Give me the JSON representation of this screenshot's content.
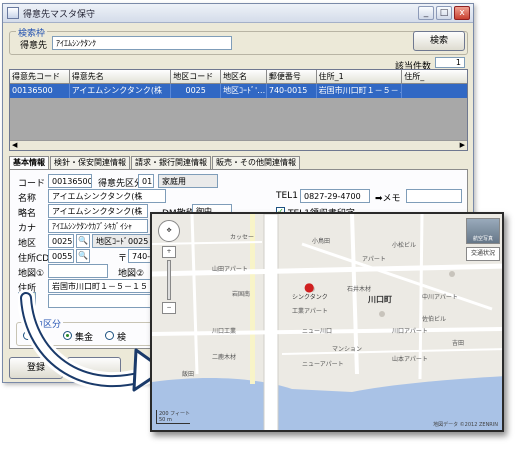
{
  "window": {
    "title": "得意先マスタ保守",
    "min_label": "_",
    "max_label": "□",
    "close_label": "x"
  },
  "search": {
    "group_title": "検索枠",
    "field_label": "得意先",
    "field_value": "ｱｲｴﾑｼﾝｸﾀﾝｸ",
    "button_label": "検索",
    "count_label": "該当件数",
    "count_value": "1"
  },
  "grid": {
    "columns": [
      "得意先コード",
      "得意先名",
      "地区コード",
      "地区名",
      "郵便番号",
      "住所_1",
      "住所_"
    ],
    "rows": [
      [
        "00136500",
        "アイエムシンクタンク(株",
        "0025",
        "地区ｺｰﾄﾞ'…",
        "740-0015",
        "岩国市川口町１－５－１５",
        ""
      ]
    ]
  },
  "tabs": [
    "基本情報",
    "検針・保安関連情報",
    "請求・銀行関連情報",
    "販売・その他関連情報"
  ],
  "form": {
    "code_label": "コード",
    "code_value": "00136500",
    "type_label": "得意先区分",
    "type_code": "01",
    "type_name": "家庭用",
    "name_label": "名称",
    "name_value": "アイエムシンクタンク(株",
    "tel_label": "TEL1",
    "tel_value": "0827-29-4700",
    "memo_label": "➡メモ",
    "short_label": "略名",
    "short_value": "アイエムシンクタンク(株",
    "dm_label": "DM敬称",
    "dm_value": "御中",
    "tel_print_label": "TEL1領収書印字",
    "kana_label": "カナ",
    "kana_value": "ｱｲｴﾑｼﾝｸﾀﾝｸｶﾌﾞｼｷｶﾞｲｼｬ",
    "area_label": "地区",
    "area_code": "0025",
    "area_name": "地区ｺｰﾄﾞ0025",
    "addrcd_label": "住所CD",
    "addrcd_value": "0055",
    "zip_mark": "〒",
    "zip_value": "740-0",
    "map1_label": "地図①",
    "map2_label": "地図②",
    "addr_label": "住所",
    "addr_value": "岩国市川口町１－５－１５",
    "input_group": "入力区分",
    "radio_left": "台",
    "radio_mid": "集金",
    "radio_right": "検"
  },
  "footer": {
    "register_label": "登録"
  },
  "map": {
    "aerial_label": "航空写真",
    "traffic_label": "交通状況",
    "district_label": "川口町",
    "marker_label": "シンクタンク",
    "scale_label": "200 フィート",
    "scale_label2": "50 m",
    "copyright": "地図データ ©2012 ZENRIN",
    "places": [
      "カッセー",
      "小鳥田",
      "小松ビル",
      "山田アパート",
      "石井木材",
      "岩国南",
      "中川アパート",
      "工業アパート",
      "川口工業",
      "ニュー川口",
      "川口アパート",
      "マンション",
      "二鹿木材",
      "佐伯ビル",
      "山本アパート",
      "ニューアパート",
      "飯田",
      "吉田",
      "アパート"
    ]
  },
  "colors": {
    "selection": "#3168c4",
    "accent": "#2050b0"
  }
}
